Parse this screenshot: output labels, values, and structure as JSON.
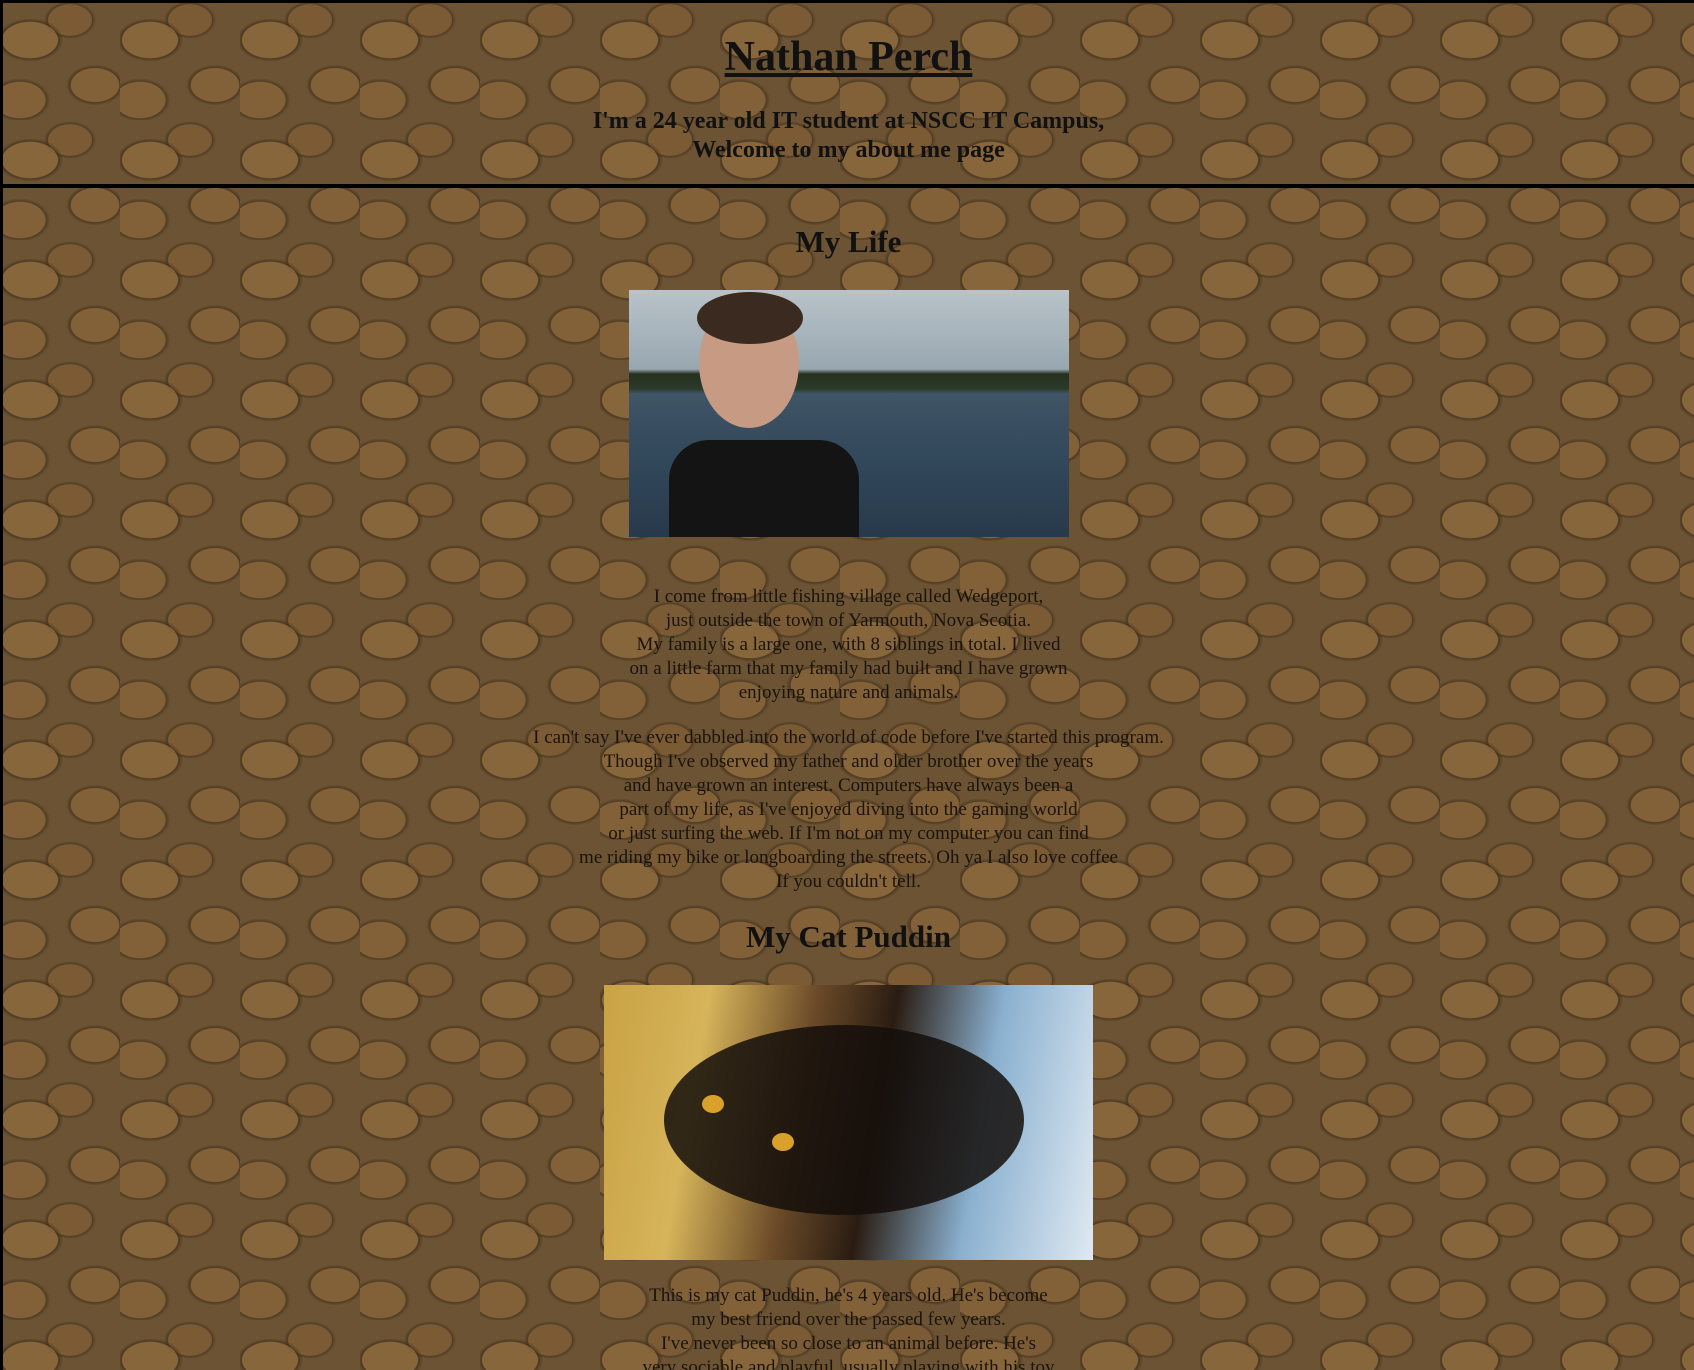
{
  "header": {
    "name": "Nathan Perch",
    "tagline_line1": "I'm a 24 year old IT student at NSCC IT Campus,",
    "tagline_line2": "Welcome to my about me page"
  },
  "life": {
    "title": "My Life",
    "para1": [
      "I come from little fishing village called Wedgeport,",
      "just outside the town of Yarmouth, Nova Scotia.",
      "My family is a large one, with 8 siblings in total. I lived",
      "on a little farm that my family had built and I have grown",
      "enjoying nature and animals."
    ],
    "para2": [
      "I can't say I've ever dabbled into the world of code before I've started this program.",
      "Though I've observed my father and older brother over the years",
      "and have grown an interest. Computers have always been a",
      "part of my life, as I've enjoyed diving into the gaming world",
      "or just surfing the web. If I'm not on my computer you can find",
      "me riding my bike or longboarding the streets. Oh ya I also love coffee",
      "If you couldn't tell."
    ]
  },
  "cat": {
    "title": "My Cat Puddin",
    "para": [
      "This is my cat Puddin, he's 4 years old. He's become",
      "my best friend over the passed few years.",
      "I've never been so close to an animal before. He's",
      "very sociable and playful, usually playing with his toy"
    ]
  }
}
